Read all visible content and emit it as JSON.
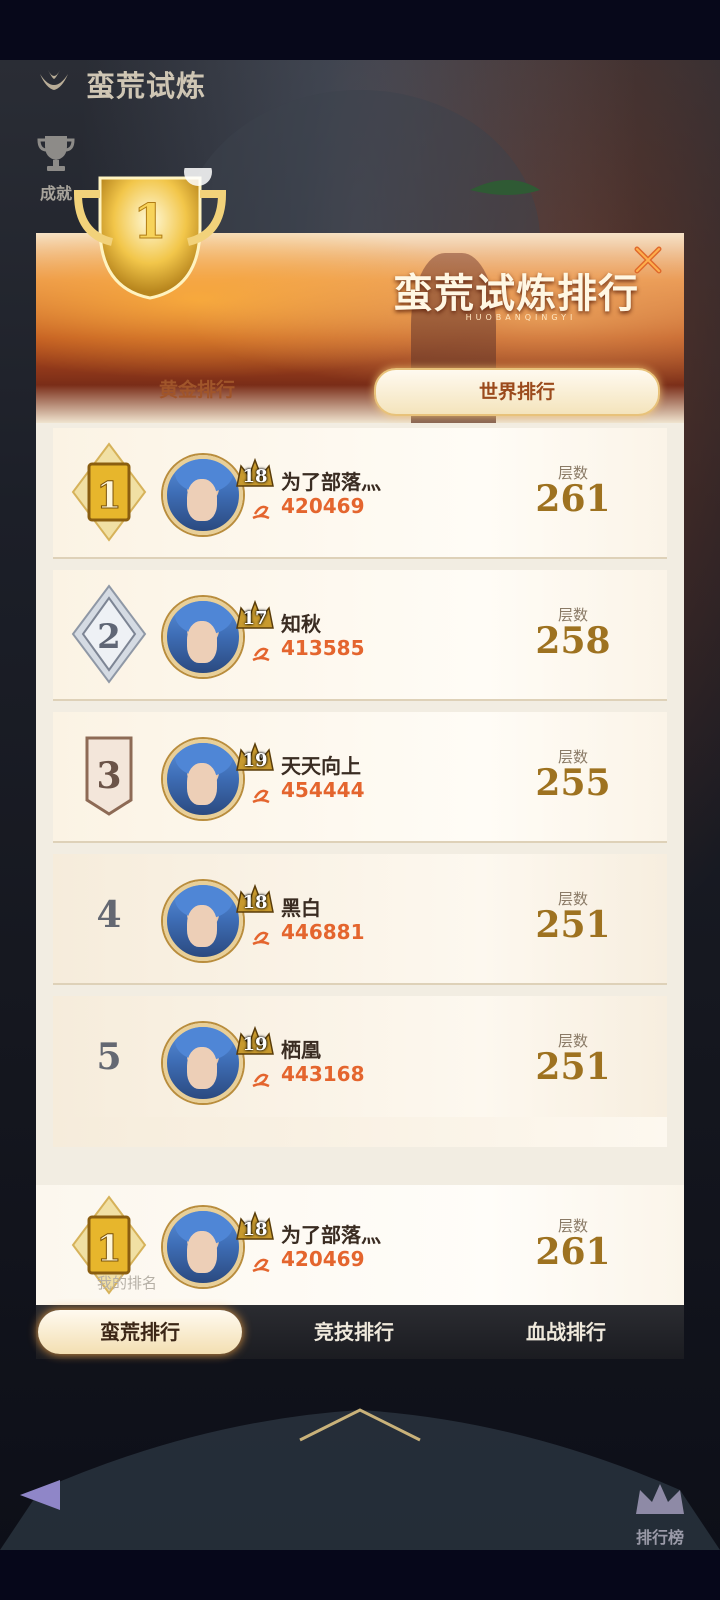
{
  "header": {
    "title": "蛮荒试炼"
  },
  "side": {
    "achievement_label": "成就"
  },
  "panel": {
    "title": "蛮荒试炼排行",
    "subtitle": "HUOBANQINGYI",
    "tabs": [
      {
        "label": "黄金排行",
        "active": false
      },
      {
        "label": "世界排行",
        "active": true
      }
    ]
  },
  "rows": [
    {
      "rank": "1",
      "level": "18",
      "name": "为了部落灬",
      "power": "420469",
      "floor_label": "层数",
      "floor": "261"
    },
    {
      "rank": "2",
      "level": "17",
      "name": "知秋",
      "power": "413585",
      "floor_label": "层数",
      "floor": "258"
    },
    {
      "rank": "3",
      "level": "19",
      "name": "天天向上",
      "power": "454444",
      "floor_label": "层数",
      "floor": "255"
    },
    {
      "rank": "4",
      "level": "18",
      "name": "黑白",
      "power": "446881",
      "floor_label": "层数",
      "floor": "251"
    },
    {
      "rank": "5",
      "level": "19",
      "name": "栖凰",
      "power": "443168",
      "floor_label": "层数",
      "floor": "251"
    }
  ],
  "my_rank": {
    "label": "我的排名",
    "rank": "1",
    "level": "18",
    "name": "为了部落灬",
    "power": "420469",
    "floor_label": "层数",
    "floor": "261"
  },
  "category_tabs": [
    {
      "label": "蛮荒排行",
      "active": true
    },
    {
      "label": "竞技排行",
      "active": false
    },
    {
      "label": "血战排行",
      "active": false
    }
  ],
  "bottom": {
    "leaderboard_label": "排行榜"
  },
  "colors": {
    "accent_orange": "#e4652e",
    "gold": "#9e7220",
    "panel_bg": "#f2ede2"
  },
  "icons": {
    "close": "close-icon",
    "trophy": "trophy-icon",
    "crown": "crown-icon"
  }
}
